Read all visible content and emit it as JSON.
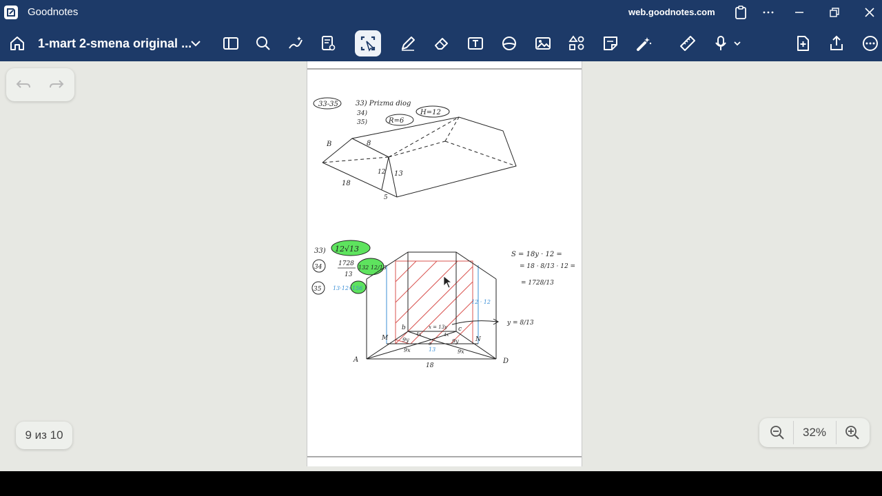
{
  "window": {
    "app_name": "Goodnotes",
    "site": "web.goodnotes.com"
  },
  "toolbar": {
    "document_title": "1-mart 2-smena original ...",
    "tools": [
      "home-icon",
      "sidebar-icon",
      "search-icon",
      "magic-pen-icon",
      "read-only-icon",
      "lasso-icon",
      "pen-icon",
      "eraser-icon",
      "text-icon",
      "shapes-icon",
      "image-icon",
      "elements-icon",
      "sticky-note-icon",
      "laser-pointer-icon",
      "ruler-icon",
      "audio-record-icon",
      "add-page-icon",
      "share-icon",
      "more-icon"
    ],
    "active_tool": "lasso-icon"
  },
  "canvas": {
    "page_indicator": "9 из 10",
    "zoom": "32%",
    "colors": {
      "canvas_bg": "#e7e8e3",
      "header_bg": "#1d3a68",
      "ink": "#222222",
      "red_ink": "#d9534f",
      "blue_ink": "#3b8fd6",
      "highlight": "#5ee35e"
    }
  },
  "notes": {
    "top": {
      "range": "33-35",
      "title": "33) Prizma diog",
      "item34": "34)",
      "item35": "35)",
      "r": "R=6",
      "h": "H=12",
      "b_label": "B",
      "eight": "8",
      "twelve": "12",
      "thirteen": "13",
      "eighteen": "18",
      "five": "5"
    },
    "bottom": {
      "n33": "33)",
      "a33": "12√13",
      "n34": "34",
      "f34_num": "1728",
      "f34_den": "13",
      "a34": "132 12/13",
      "n35": "35",
      "f35": "13·12=",
      "a35": "156",
      "s_line1": "S = 18y · 12 =",
      "s_line2": "= 18 · 8/13 · 12 =",
      "s_line3": "= 1728/13",
      "y_eq": "y = 8/13",
      "label_1212": "12 · 12",
      "A": "A",
      "D": "D",
      "M": "M",
      "N": "N",
      "b": "b",
      "c": "c",
      "x_eq": "x = 13y",
      "eighteen": "18",
      "nine_x_l": "9x",
      "nine_x_r": "9x",
      "nine_y_l": "9y",
      "nine_y_r": "9y",
      "four_x_l": "4x",
      "four_x_r": "4x",
      "o": "o",
      "thirteen": "13"
    }
  }
}
